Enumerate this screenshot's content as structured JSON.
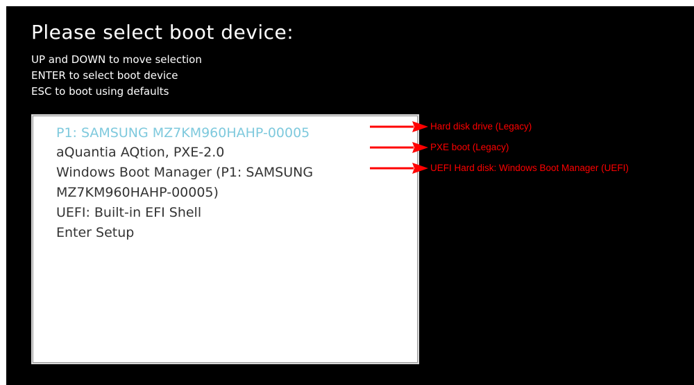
{
  "colors": {
    "background": "#000000",
    "text": "#ffffff",
    "menu_background": "#ffffff",
    "menu_text": "#333333",
    "selected_text": "#7ec9dd",
    "annotation": "#ff0000"
  },
  "title": "Please select boot device:",
  "instructions": [
    "UP and DOWN to move selection",
    "ENTER to select boot device",
    "ESC to boot using defaults"
  ],
  "menu": {
    "selected_index": 0,
    "items": [
      "P1: SAMSUNG MZ7KM960HAHP-00005",
      "aQuantia AQtion, PXE-2.0",
      "Windows Boot Manager (P1: SAMSUNG",
      "MZ7KM960HAHP-00005)",
      "UEFI: Built-in EFI Shell",
      "Enter Setup"
    ]
  },
  "annotations": [
    "Hard disk drive (Legacy)",
    "PXE boot (Legacy)",
    "UEFI Hard disk: Windows Boot Manager (UEFI)"
  ]
}
